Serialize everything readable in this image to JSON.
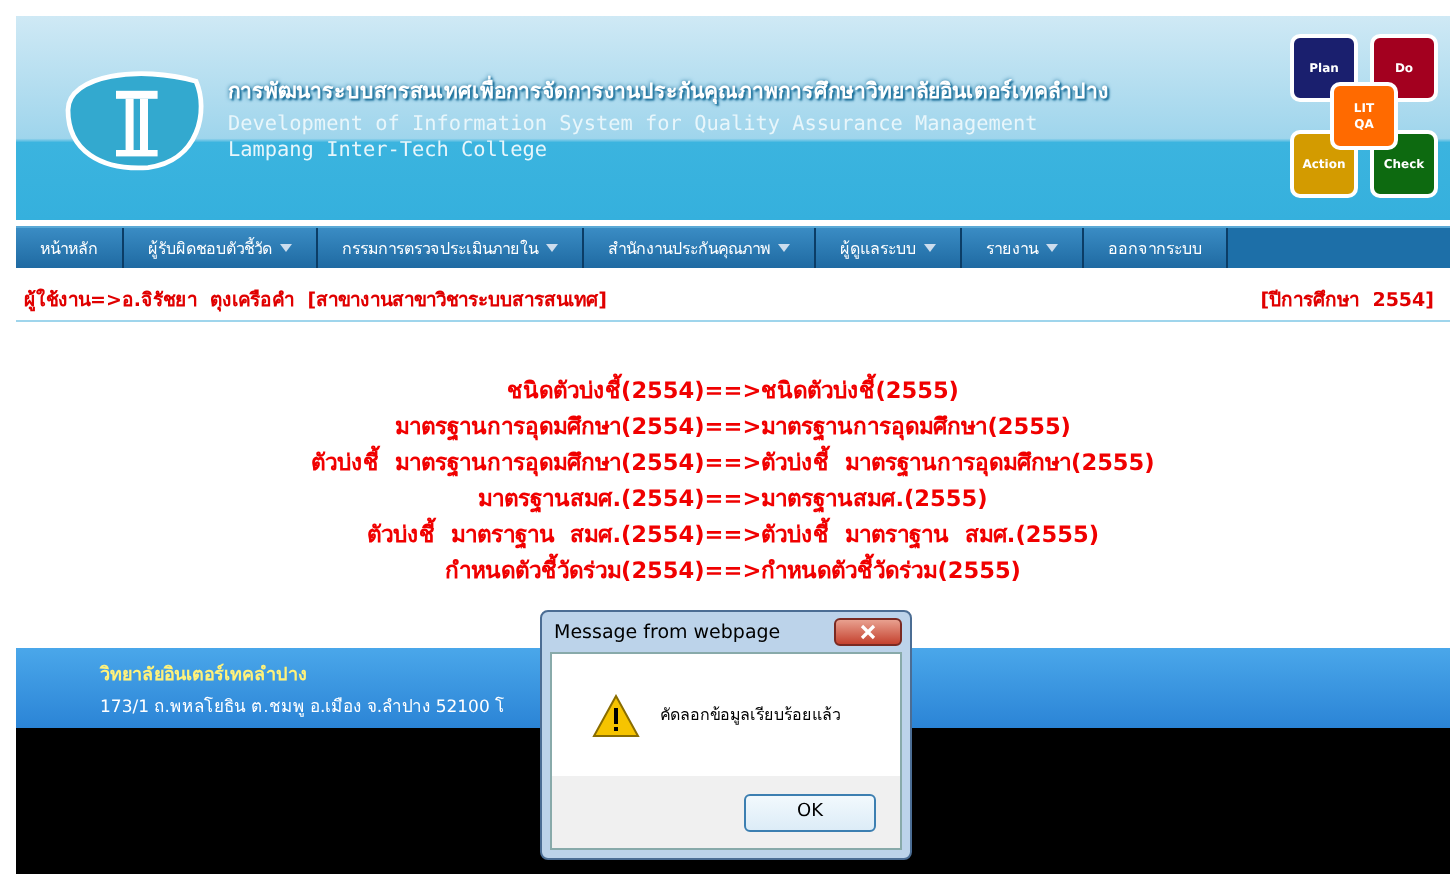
{
  "header": {
    "title_th": "การพัฒนาระบบสารสนเทศเพื่อการจัดการงานประกันคุณภาพการศึกษาวิทยาลัยอินเตอร์เทคลำปาง",
    "title_en": "Development of Information System for Quality Assurance Management",
    "college_en": "Lampang Inter-Tech College",
    "pdca": {
      "plan": "Plan",
      "do": "Do",
      "action": "Action",
      "check": "Check",
      "center_top": "LIT",
      "center_bottom": "QA"
    }
  },
  "nav": [
    {
      "label": "หน้าหลัก",
      "has_menu": false
    },
    {
      "label": "ผู้รับผิดชอบตัวชี้วัด",
      "has_menu": true
    },
    {
      "label": "กรรมการตรวจประเมินภายใน",
      "has_menu": true
    },
    {
      "label": "สำนักงานประกันคุณภาพ",
      "has_menu": true
    },
    {
      "label": "ผู้ดูแลระบบ",
      "has_menu": true
    },
    {
      "label": "รายงาน",
      "has_menu": true
    },
    {
      "label": "ออกจากระบบ",
      "has_menu": false
    }
  ],
  "user_bar": {
    "user": "ผู้ใช้งาน=>อ.จิรัชยา  ตุงเครือคำ  [สาขางานสาขาวิชาระบบสารสนเทศ]",
    "year": "[ปีการศึกษา  2554]"
  },
  "messages": [
    "ชนิดตัวบ่งชี้(2554)==>ชนิดตัวบ่งชี้(2555)",
    "มาตรฐานการอุดมศึกษา(2554)==>มาตรฐานการอุดมศึกษา(2555)",
    "ตัวบ่งชี้  มาตรฐานการอุดมศึกษา(2554)==>ตัวบ่งชี้  มาตรฐานการอุดมศึกษา(2555)",
    "มาตรฐานสมศ.(2554)==>มาตรฐานสมศ.(2555)",
    "ตัวบ่งชี้  มาตราฐาน  สมศ.(2554)==>ตัวบ่งชี้  มาตราฐาน  สมศ.(2555)",
    "กำหนดตัวชี้วัดร่วม(2554)==>กำหนดตัวชี้วัดร่วม(2555)"
  ],
  "footer": {
    "name": "วิทยาลัยอินเตอร์เทคลำปาง",
    "address": "173/1 ถ.พหลโยธิน ต.ชมพู อ.เมือง จ.ลำปาง 52100 โ"
  },
  "dialog": {
    "title": "Message from webpage",
    "message": "คัดลอกข้อมูลเรียบร้อยแล้ว",
    "button": "OK"
  }
}
